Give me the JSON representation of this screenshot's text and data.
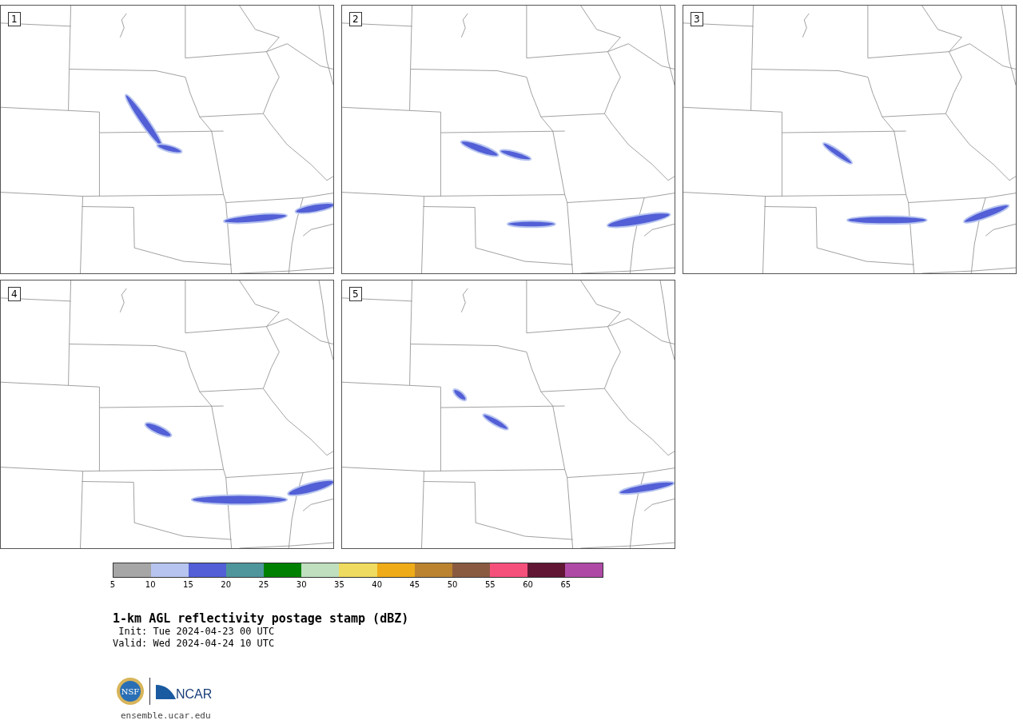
{
  "panels": [
    {
      "label": "1"
    },
    {
      "label": "2"
    },
    {
      "label": "3"
    },
    {
      "label": "4"
    },
    {
      "label": "5"
    }
  ],
  "colorbar": {
    "bins": [
      {
        "color": "#a6a6a6",
        "label": "5"
      },
      {
        "color": "#b7c4ef",
        "label": "10"
      },
      {
        "color": "#525fd6",
        "label": "15"
      },
      {
        "color": "#4f959c",
        "label": "20"
      },
      {
        "color": "#008000",
        "label": "25"
      },
      {
        "color": "#bfdfbf",
        "label": "30"
      },
      {
        "color": "#efdb5f",
        "label": "35"
      },
      {
        "color": "#efac18",
        "label": "40"
      },
      {
        "color": "#bb832f",
        "label": "45"
      },
      {
        "color": "#8a5a40",
        "label": "50"
      },
      {
        "color": "#f5507c",
        "label": "55"
      },
      {
        "color": "#611633",
        "label": "60"
      },
      {
        "color": "#ae4aa5",
        "label": "65"
      }
    ]
  },
  "title": "1-km AGL reflectivity postage stamp (dBZ)",
  "init": " Init: Tue 2024-04-23 00 UTC",
  "valid": "Valid: Wed 2024-04-24 10 UTC",
  "logos": {
    "nsf": "NSF",
    "ncar": "NCAR"
  },
  "footer": "ensemble.ucar.edu"
}
